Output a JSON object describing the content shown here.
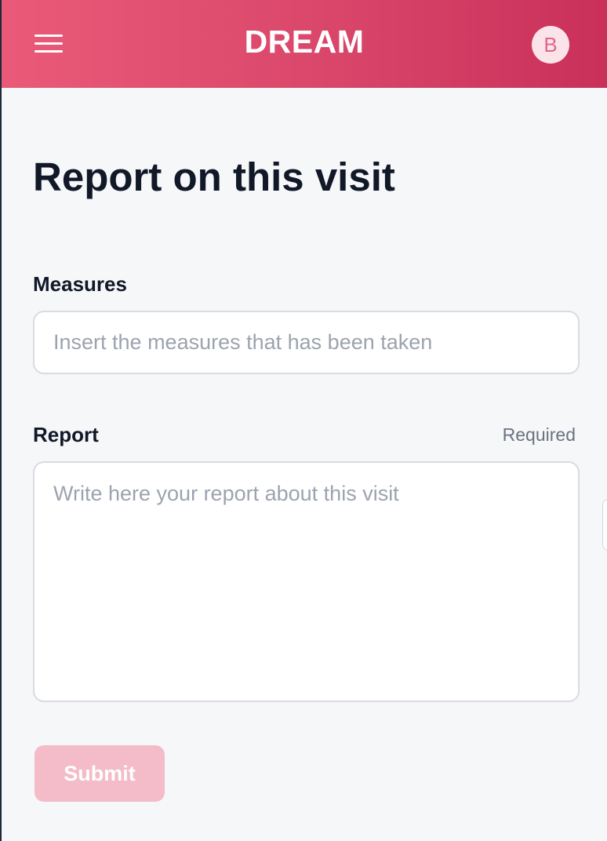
{
  "header": {
    "brand": "DREAM",
    "avatar_initial": "B",
    "menu_icon": "hamburger-menu-icon"
  },
  "form": {
    "title": "Report on this visit",
    "measures": {
      "label": "Measures",
      "placeholder": "Insert the measures that has been taken",
      "value": ""
    },
    "report": {
      "label": "Report",
      "required_text": "Required",
      "placeholder": "Write here your report about this visit",
      "value": ""
    },
    "submit_label": "Submit"
  },
  "colors": {
    "header_gradient_start": "#ea5a78",
    "header_gradient_end": "#c9305a",
    "submit_disabled_bg": "#f3bcc8",
    "avatar_bg": "#fbe3ea",
    "avatar_text": "#e0668a"
  }
}
